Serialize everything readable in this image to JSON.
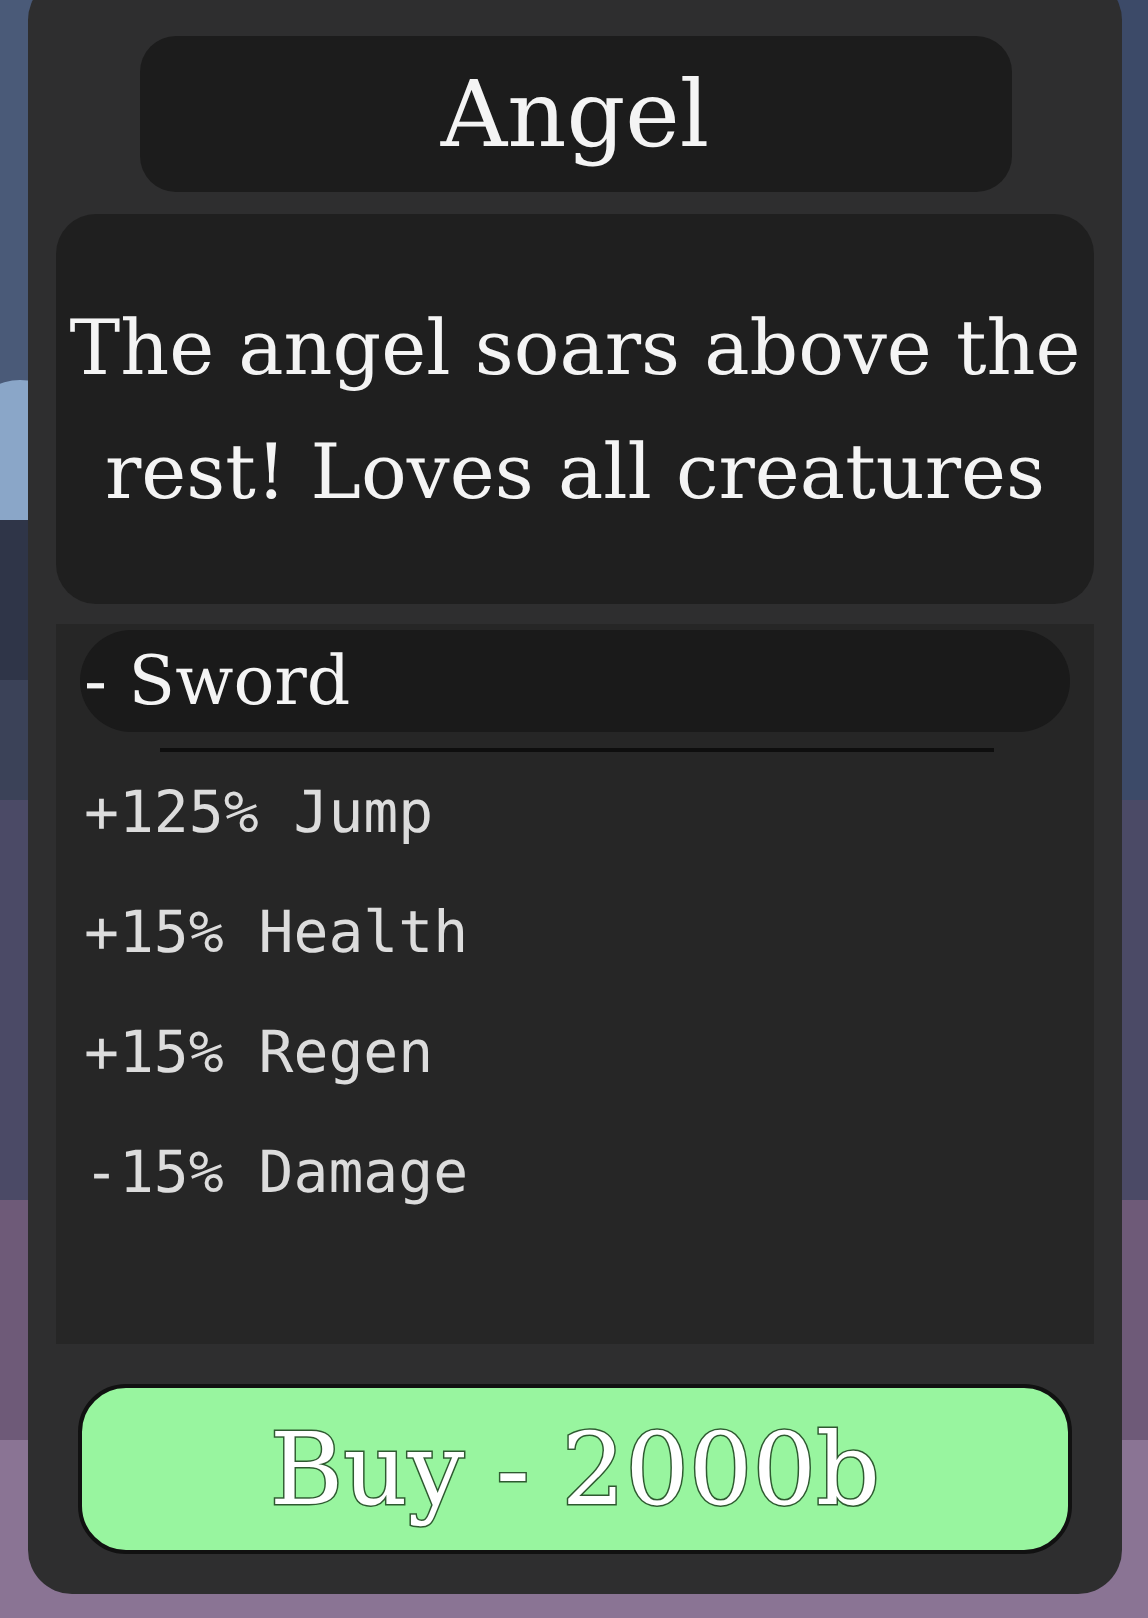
{
  "title": "Angel",
  "description": "The angel soars above the rest! Loves all creatures",
  "weapon": "- Sword",
  "stats": [
    "+125% Jump",
    "+15% Health",
    "+15% Regen",
    "-15% Damage"
  ],
  "buy_button": "Buy - 2000b"
}
